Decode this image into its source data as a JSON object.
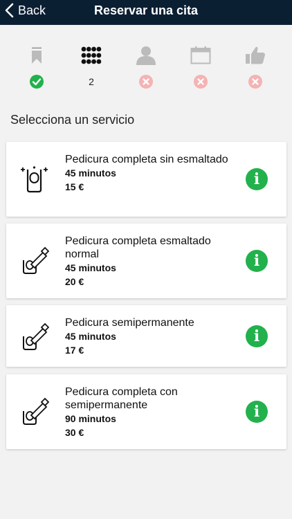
{
  "nav": {
    "back_label": "Back",
    "title": "Reservar una cita"
  },
  "steps": [
    {
      "name": "bookmark-icon",
      "status": "done"
    },
    {
      "name": "grid-icon",
      "status": "current",
      "number": "2"
    },
    {
      "name": "person-icon",
      "status": "pending"
    },
    {
      "name": "calendar-icon",
      "status": "pending"
    },
    {
      "name": "thumbs-up-icon",
      "status": "pending"
    }
  ],
  "section_title": "Selecciona un servicio",
  "services": [
    {
      "icon": "nail-sparkle-icon",
      "name": "Pedicura completa sin esmaltado",
      "duration": "45 minutos",
      "price": "15 €"
    },
    {
      "icon": "nail-polish-icon",
      "name": "Pedicura completa esmaltado normal",
      "duration": "45 minutos",
      "price": "20 €"
    },
    {
      "icon": "nail-polish-icon",
      "name": "Pedicura semipermanente",
      "duration": "45 minutos",
      "price": "17 €"
    },
    {
      "icon": "nail-polish-icon",
      "name": "Pedicura completa con semipermanente",
      "duration": "90 minutos",
      "price": "30 €"
    }
  ],
  "colors": {
    "navbar": "#0b1f33",
    "done": "#22b14c",
    "pending": "#f5b3b3",
    "info": "#22b14c",
    "icon_gray": "#bbbbbb"
  }
}
